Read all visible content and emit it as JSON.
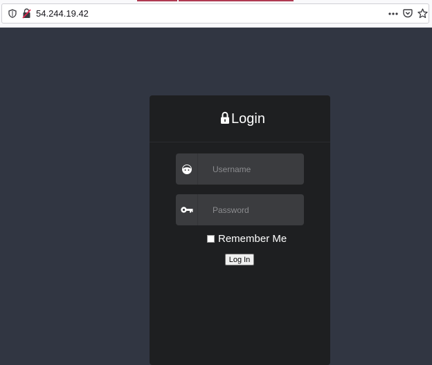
{
  "browser": {
    "url": "54.244.19.42",
    "icons": [
      "shield-icon",
      "insecure-lock-icon",
      "more-actions-icon",
      "pocket-icon",
      "bookmark-star-icon"
    ],
    "accent_color": "#b03a52"
  },
  "login": {
    "title": "Login",
    "title_icon": "padlock-icon",
    "username": {
      "value": "",
      "placeholder": "Username",
      "icon": "user-face-icon"
    },
    "password": {
      "value": "",
      "placeholder": "Password",
      "icon": "key-icon"
    },
    "remember_me": {
      "label": "Remember Me",
      "checked": false
    },
    "submit_label": "Log In"
  },
  "colors": {
    "page_background": "#313642",
    "panel_background": "#1e1f21",
    "input_background": "#3b3c3f"
  }
}
